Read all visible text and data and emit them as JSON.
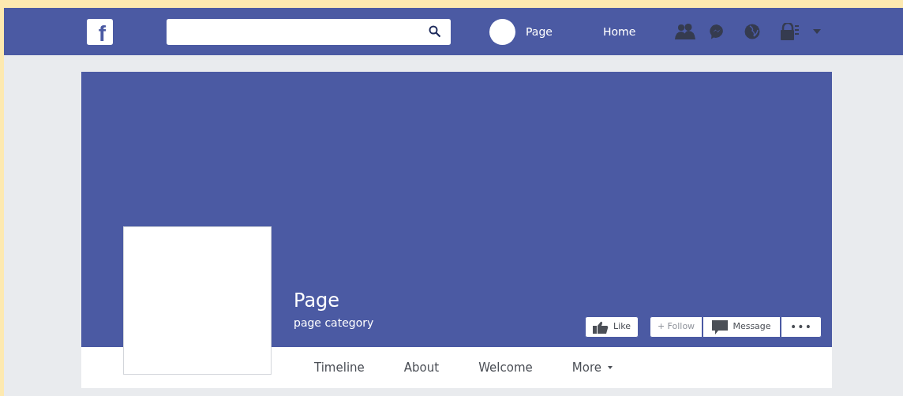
{
  "top_bar": {
    "logo": "f",
    "profile_link": "Page",
    "home_link": "Home"
  },
  "cover": {
    "page_name": "Page",
    "category": "page category",
    "buttons": [
      {
        "kind": "like",
        "label": "Like"
      },
      {
        "kind": "follow",
        "label": "+ Follow"
      },
      {
        "kind": "message",
        "label": "Message"
      },
      {
        "kind": "more",
        "label": "•••"
      }
    ]
  },
  "tabs": [
    {
      "label": "Timeline",
      "kind": "plain"
    },
    {
      "label": "About",
      "kind": "plain"
    },
    {
      "label": "Welcome",
      "kind": "plain"
    },
    {
      "label": "More",
      "kind": "menu"
    }
  ]
}
